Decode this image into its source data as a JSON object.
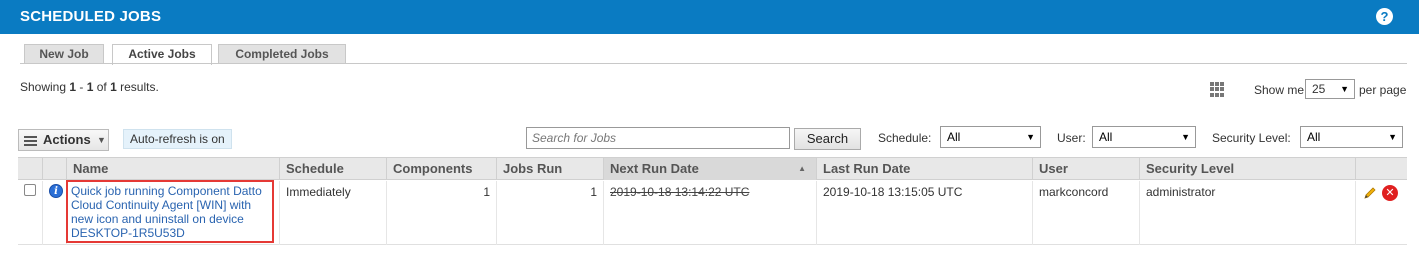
{
  "header": {
    "title": "SCHEDULED JOBS",
    "help_label": "?"
  },
  "tabs": [
    {
      "label": "New Job"
    },
    {
      "label": "Active Jobs"
    },
    {
      "label": "Completed Jobs"
    }
  ],
  "results": {
    "prefix": "Showing ",
    "from": "1",
    "sep1": " - ",
    "to": "1",
    "of_word": " of ",
    "total": "1",
    "suffix": " results."
  },
  "pagination": {
    "show_me_label": "Show me",
    "per_page_value": "25",
    "per_page_label": "per page"
  },
  "toolbar": {
    "actions_label": "Actions",
    "auto_refresh_label": "Auto-refresh is on",
    "search_placeholder": "Search for Jobs",
    "search_button": "Search"
  },
  "filters": {
    "schedule_label": "Schedule:",
    "schedule_value": "All",
    "user_label": "User:",
    "user_value": "All",
    "security_label": "Security Level:",
    "security_value": "All"
  },
  "table": {
    "columns": [
      "Name",
      "Schedule",
      "Components",
      "Jobs Run",
      "Next Run Date",
      "Last Run Date",
      "User",
      "Security Level"
    ],
    "rows": [
      {
        "name": "Quick job running Component Datto Cloud Continuity Agent [WIN] with new icon and uninstall on device DESKTOP-1R5U53D",
        "schedule": "Immediately",
        "components": "1",
        "jobs_run": "1",
        "next_run_date": "2019-10-18 13:14:22 UTC",
        "last_run_date": "2019-10-18 13:15:05 UTC",
        "user": "markconcord",
        "security_level": "administrator"
      }
    ]
  },
  "colors": {
    "header_bg": "#0a7bc2",
    "highlight_border": "#e53935",
    "link": "#2a64b0"
  },
  "icons": [
    "help-icon",
    "grid-view-icon",
    "menu-icon",
    "info-icon",
    "edit-pencil-icon",
    "delete-icon"
  ]
}
